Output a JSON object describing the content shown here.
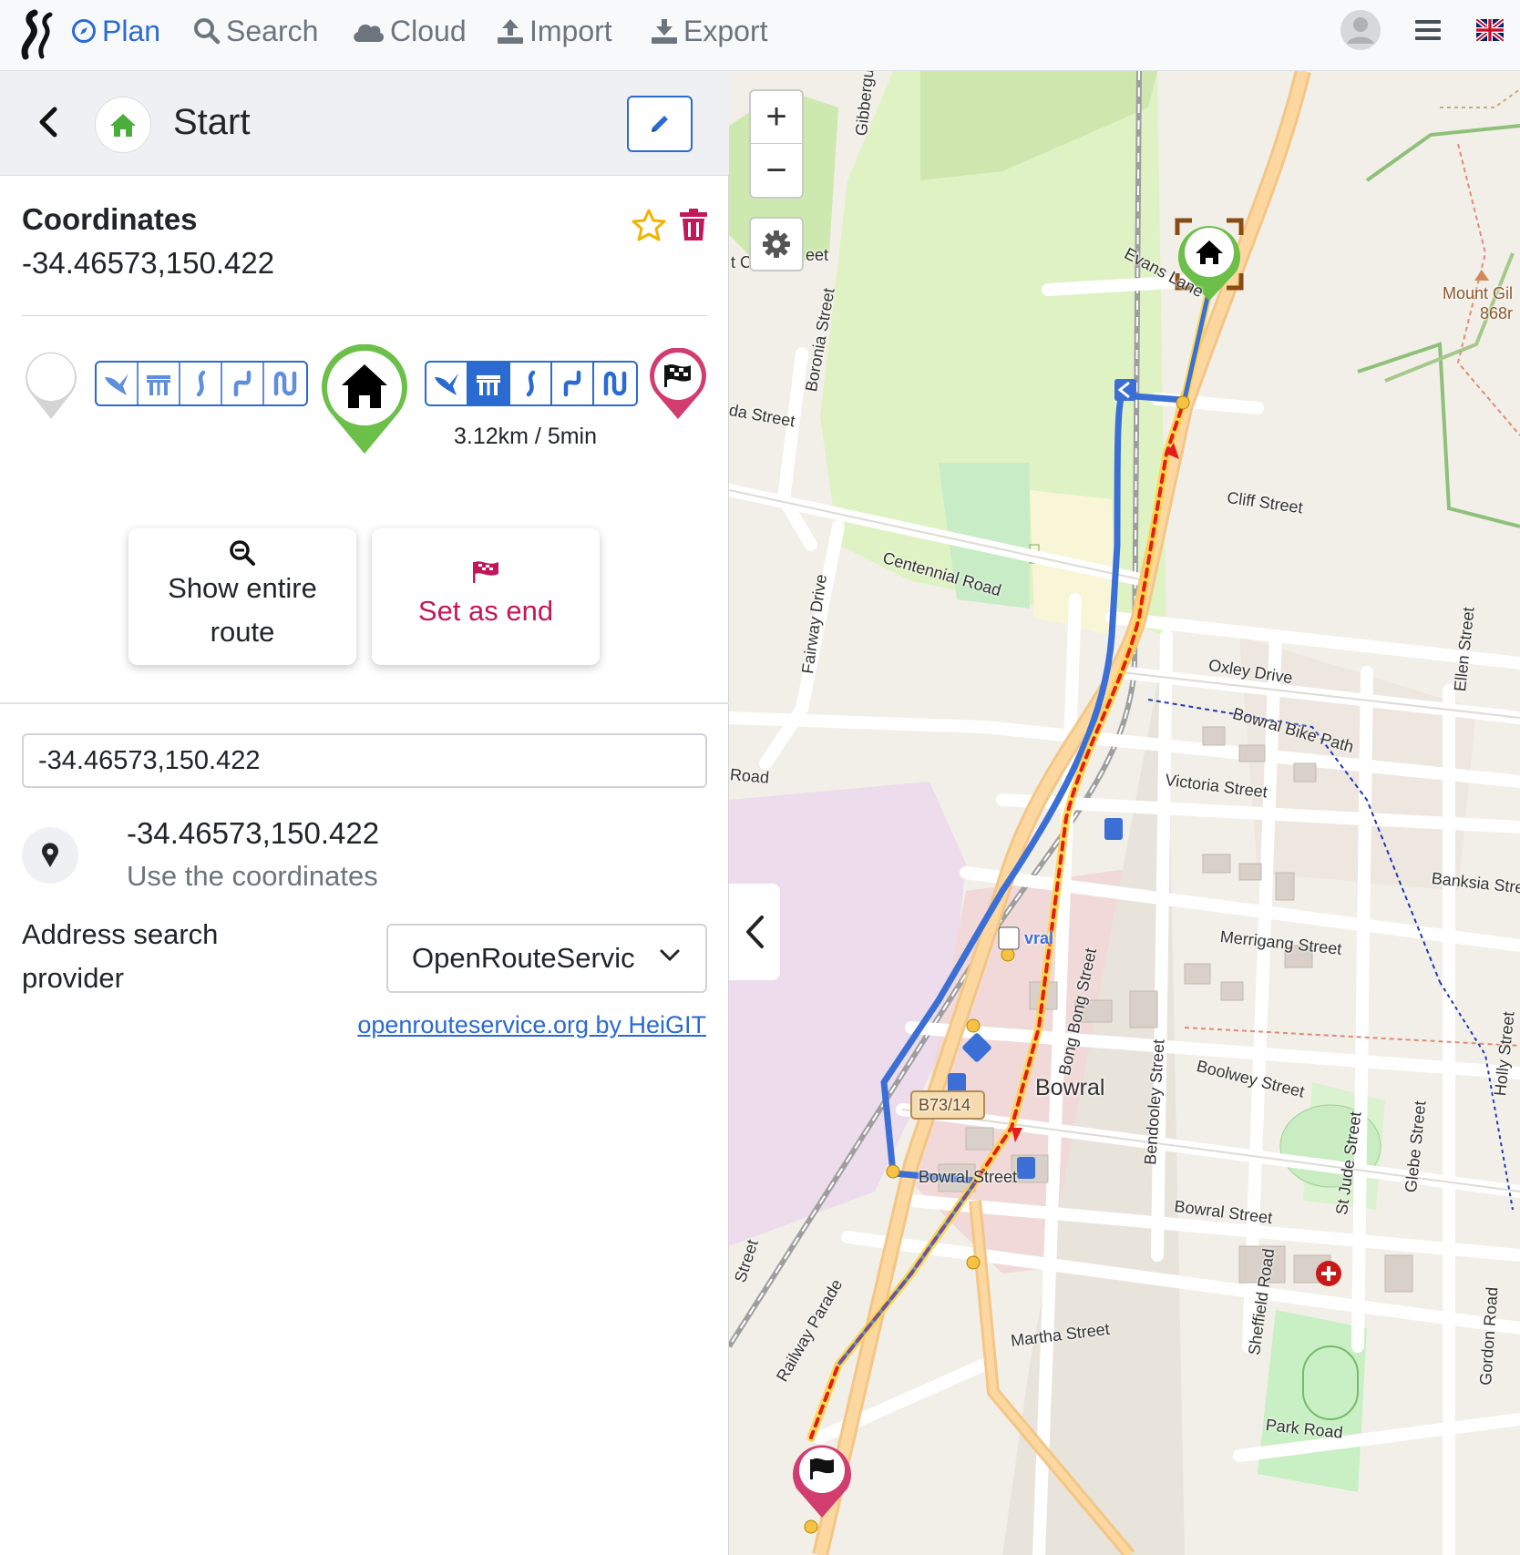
{
  "navbar": {
    "plan_label": "Plan",
    "search_label": "Search",
    "cloud_label": "Cloud",
    "import_label": "Import",
    "export_label": "Export",
    "accent_color": "#2a6ad1",
    "muted_color": "#6c757d",
    "language_flag": "uk-flag-icon"
  },
  "waypoint": {
    "title": "Start",
    "coordinates_label": "Coordinates",
    "coordinates_value": "-34.46573,150.422",
    "route_info": "3.12km / 5min",
    "start_color": "#6cc04a",
    "end_color": "#d23d6f"
  },
  "actions": {
    "show_route_line1": "Show entire",
    "show_route_line2": "route",
    "set_end_label": "Set as end",
    "set_end_color": "#c2185b"
  },
  "search": {
    "input_value": "-34.46573,150.422",
    "result_title": "-34.46573,150.422",
    "result_subtitle": "Use the coordinates",
    "provider_label": "Address search provider",
    "provider_value": "OpenRouteServic",
    "provider_link": "openrouteservice.org by HeiGIT"
  },
  "map": {
    "zoom_in": "+",
    "zoom_out": "−",
    "labels": {
      "gibbergunya": "Gibbergunya Walk",
      "evans": "Evans Lane",
      "mount": "Mount Gil",
      "mount_elev": "868r",
      "boronia": "Boronia Street",
      "ida": "da Street",
      "cliff": "Cliff Street",
      "centennial": "Centennial Road",
      "fairway": "Fairway Drive",
      "oxley": "Oxley Drive",
      "ellen": "Ellen Street",
      "bowral_bike": "Bowral Bike Path",
      "road": "Road",
      "victoria": "Victoria Street",
      "banksia": "Banksia Stre",
      "merrigang": "Merrigang Street",
      "bong_bong": "Bong Bong Street",
      "bowral_town": "Bowral",
      "station": "vral",
      "b73": "B73/14",
      "boolwey": "Boolwey Street",
      "bendooley": "Bendooley Street",
      "bowral_st1": "Bowral Street",
      "bowral_st2": "Bowral Street",
      "st_jude": "St Jude Street",
      "glebe": "Glebe Street",
      "holly": "Holly Street",
      "martha": "Martha Street",
      "sheffield": "Sheffield Road",
      "gordon": "Gordon Road",
      "park": "Park Road",
      "railway": "Railway Parade",
      "street_left": "Street",
      "cl_street": "t Cl",
      "eet": "eet"
    }
  }
}
